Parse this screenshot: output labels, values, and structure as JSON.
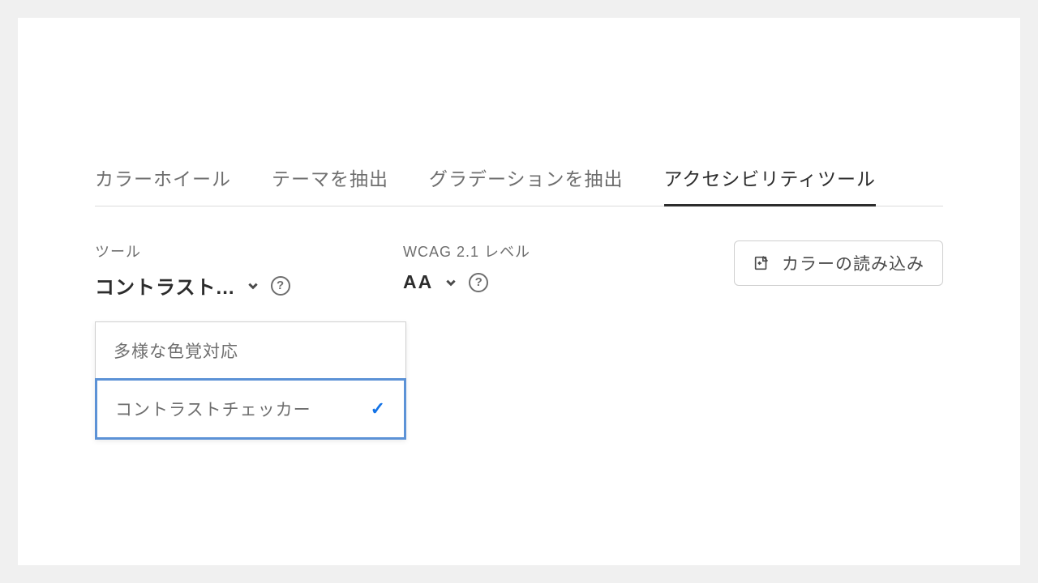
{
  "tabs": [
    {
      "label": "カラーホイール",
      "active": false
    },
    {
      "label": "テーマを抽出",
      "active": false
    },
    {
      "label": "グラデーションを抽出",
      "active": false
    },
    {
      "label": "アクセシビリティツール",
      "active": true
    }
  ],
  "tool": {
    "label": "ツール",
    "value": "コントラスト...",
    "options": [
      {
        "label": "多様な色覚対応",
        "selected": false
      },
      {
        "label": "コントラストチェッカー",
        "selected": true
      }
    ]
  },
  "wcag": {
    "label": "WCAG 2.1 レベル",
    "value": "AA"
  },
  "loadButton": {
    "label": "カラーの読み込み"
  },
  "help": {
    "symbol": "?"
  }
}
